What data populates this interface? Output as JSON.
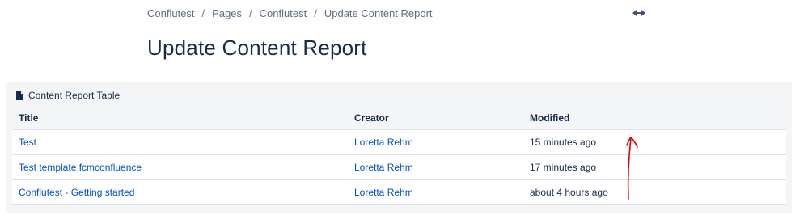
{
  "breadcrumb": {
    "items": [
      "Conflutest",
      "Pages",
      "Conflutest",
      "Update Content Report"
    ],
    "separator": "/"
  },
  "header": {
    "width_toggle_icon": "expand-width-icon"
  },
  "page": {
    "title": "Update Content Report"
  },
  "report": {
    "header_icon": "document-icon",
    "header_label": "Content Report Table",
    "columns": [
      "Title",
      "Creator",
      "Modified"
    ],
    "rows": [
      {
        "title": "Test",
        "creator": "Loretta Rehm",
        "modified": "15 minutes ago"
      },
      {
        "title": "Test template fcmconfluence",
        "creator": "Loretta Rehm",
        "modified": "17 minutes ago"
      },
      {
        "title": "Conflutest - Getting started",
        "creator": "Loretta Rehm",
        "modified": "about 4 hours ago"
      }
    ]
  },
  "annotation": {
    "icon": "red-arrow-up-annotation",
    "color": "#e00000"
  },
  "colors": {
    "link": "#0052cc",
    "text": "#172b4d",
    "muted": "#5e6c84",
    "panel_bg": "#f4f5f7",
    "border": "#dfe1e6"
  }
}
